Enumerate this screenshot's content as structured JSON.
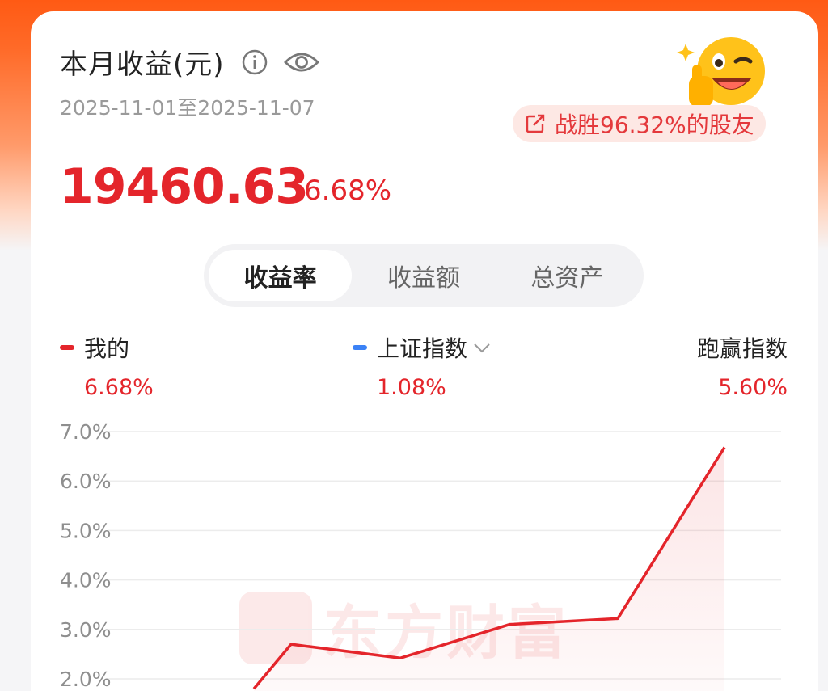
{
  "header": {
    "title": "本月收益(元)",
    "date_range": "2025-11-01至2025-11-07",
    "beat_text": "战胜96.32%的股友",
    "info_icon": "info-icon",
    "eye_icon": "eye-icon",
    "share_icon": "share-icon"
  },
  "summary": {
    "amount": "19460.63",
    "rate": "6.68%"
  },
  "tabs": [
    {
      "label": "收益率",
      "active": true
    },
    {
      "label": "收益额",
      "active": false
    },
    {
      "label": "总资产",
      "active": false
    }
  ],
  "legend": {
    "mine": {
      "label": "我的",
      "value": "6.68%",
      "color": "#e4252b"
    },
    "index": {
      "label": "上证指数",
      "value": "1.08%",
      "color": "#3b82f6"
    },
    "outperform": {
      "label": "跑赢指数",
      "value": "5.60%"
    }
  },
  "watermark": {
    "text": "东方财富"
  },
  "colors": {
    "accent": "#e4252b",
    "brand": "#ff5a14"
  },
  "chart_data": {
    "type": "line",
    "y_ticks": [
      "7.0%",
      "6.0%",
      "5.0%",
      "4.0%",
      "3.0%",
      "2.0%"
    ],
    "ylim": [
      2.0,
      7.0
    ],
    "series": [
      {
        "name": "我的",
        "points": [
          [
            0,
            1.8
          ],
          [
            1,
            2.7
          ],
          [
            2,
            2.42
          ],
          [
            3,
            3.1
          ],
          [
            4,
            3.22
          ],
          [
            5,
            6.68
          ]
        ]
      }
    ]
  }
}
